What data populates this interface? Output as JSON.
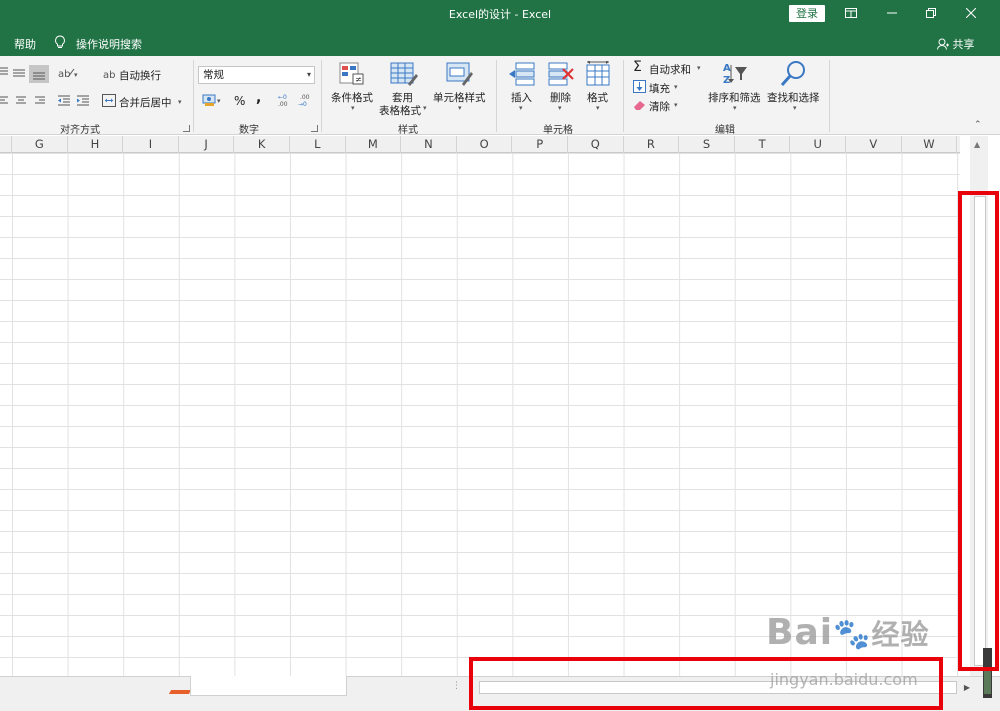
{
  "window": {
    "title": "Excel的设计  -  Excel",
    "login_label": "登录",
    "controls": [
      "ribbon-display",
      "minimize",
      "restore",
      "close"
    ]
  },
  "menu": {
    "help": "帮助",
    "search_hint": "操作说明搜索",
    "share": "共享"
  },
  "ribbon": {
    "alignment": {
      "wrap_text": "自动换行",
      "merge_center": "合并后居中",
      "label": "对齐方式"
    },
    "number": {
      "format_value": "常规",
      "percent": "%",
      "comma": ",",
      "label": "数字"
    },
    "styles": {
      "conditional_format": "条件格式",
      "table_format_line1": "套用",
      "table_format_line2": "表格格式",
      "cell_styles": "单元格样式",
      "label": "样式"
    },
    "cells": {
      "insert": "插入",
      "delete": "删除",
      "format": "格式",
      "label": "单元格"
    },
    "editing": {
      "autosum": "自动求和",
      "fill": "填充",
      "clear": "清除",
      "sort_filter": "排序和筛选",
      "find_select": "查找和选择",
      "label": "编辑"
    }
  },
  "columns": [
    "G",
    "H",
    "I",
    "J",
    "K",
    "L",
    "M",
    "N",
    "O",
    "P",
    "Q",
    "R",
    "S",
    "T",
    "U",
    "V",
    "W"
  ],
  "watermark": {
    "brand": "Bai",
    "brand2": "经验",
    "url": "jingyan.baidu.com"
  }
}
